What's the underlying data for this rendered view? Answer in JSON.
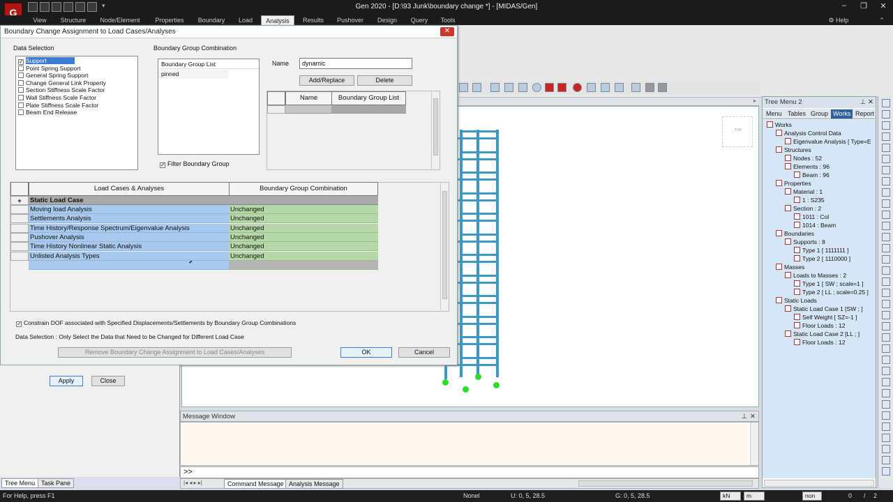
{
  "window": {
    "title": "Gen 2020 - [D:\\93 Junk\\boundary change *] - [MIDAS/Gen]",
    "help_label": "Help"
  },
  "menu": [
    "View",
    "Structure",
    "Node/Element",
    "Properties",
    "Boundary",
    "Load",
    "Analysis",
    "Results",
    "Pushover",
    "Design",
    "Query",
    "Tools"
  ],
  "active_menu": "Analysis",
  "dialog": {
    "title": "Boundary Change Assignment to Load Cases/Analyses",
    "data_selection": {
      "label": "Data Selection",
      "items": [
        {
          "label": "Support",
          "checked": true,
          "selected": true
        },
        {
          "label": "Point Spring Support",
          "checked": false
        },
        {
          "label": "General Spring Support",
          "checked": false
        },
        {
          "label": "Change General Link Property",
          "checked": false
        },
        {
          "label": "Section Stiffness Scale Factor",
          "checked": false
        },
        {
          "label": "Wall Stiffness Scale Factor",
          "checked": false
        },
        {
          "label": "Plate Stiffness Scale Factor",
          "checked": false
        },
        {
          "label": "Beam End Release",
          "checked": false
        }
      ]
    },
    "bgc": {
      "label": "Boundary Group Combination",
      "list_header": "Boundary Group List",
      "list_items": [
        "pinned"
      ],
      "filter_label": "Filter Boundary Group",
      "name_label": "Name",
      "name_value": "dynamic",
      "add_replace": "Add/Replace",
      "delete": "Delete",
      "grid_headers": [
        "Name",
        "Boundary Group List"
      ]
    },
    "table": {
      "headers": [
        "Load Cases & Analyses",
        "Boundary Group Combination"
      ],
      "group_row": {
        "marker": "+",
        "label": "Static Load Case"
      },
      "rows": [
        {
          "case": "Moving load Analysis",
          "combo": "Unchanged"
        },
        {
          "case": "Settlements Analysis",
          "combo": "Unchanged"
        },
        {
          "case": "Time History/Response Spectrum/Eigenvalue Analysis",
          "combo": "Unchanged"
        },
        {
          "case": "Pushover Analysis",
          "combo": "Unchanged"
        },
        {
          "case": "Time History Nonlinear Static Analysis",
          "combo": "Unchanged"
        },
        {
          "case": "Unlisted Analysis Types",
          "combo": "Unchanged"
        }
      ]
    },
    "constrain_label": "Constrain DOF associated with Specified Displacements/Settlements by Boundary Group Combinations",
    "note": "Data Selection : Only Select the Data that Need to be Changed for Different Load Case",
    "remove_label": "Remove Boundary Change Assignment to Load Cases/Analyses",
    "ok": "OK",
    "cancel": "Cancel"
  },
  "left_panel": {
    "apply": "Apply",
    "close": "Close",
    "tabs": [
      "Tree Menu",
      "Task Pane"
    ]
  },
  "message": {
    "title": "Message Window",
    "prompt": ">>",
    "tabs": [
      "Command Message",
      "Analysis Message"
    ]
  },
  "status": {
    "help": "For Help, press F1",
    "none": "Nonel",
    "u": "U: 0, 5, 28.5",
    "g": "G: 0, 5, 28.5",
    "unit_force": "kN",
    "unit_len": "m",
    "sel": "non",
    "page_cur": "0",
    "page_sep": "/",
    "page_tot": "2"
  },
  "tree": {
    "title": "Tree Menu 2",
    "tabs": [
      "Menu",
      "Tables",
      "Group",
      "Works",
      "Report"
    ],
    "active_tab": "Works",
    "nodes": [
      {
        "t": "Works",
        "lvl": 0
      },
      {
        "t": "Analysis Control Data",
        "lvl": 1
      },
      {
        "t": "Eigenvalue Analysis [ Type=E",
        "lvl": 2
      },
      {
        "t": "Structures",
        "lvl": 1
      },
      {
        "t": "Nodes : 52",
        "lvl": 2
      },
      {
        "t": "Elements : 96",
        "lvl": 2
      },
      {
        "t": "Beam : 96",
        "lvl": 3
      },
      {
        "t": "Properties",
        "lvl": 1
      },
      {
        "t": "Material : 1",
        "lvl": 2
      },
      {
        "t": "1 : S235",
        "lvl": 3
      },
      {
        "t": "Section : 2",
        "lvl": 2
      },
      {
        "t": "1011 : Col",
        "lvl": 3
      },
      {
        "t": "1014 : Beam",
        "lvl": 3
      },
      {
        "t": "Boundaries",
        "lvl": 1
      },
      {
        "t": "Supports : 8",
        "lvl": 2
      },
      {
        "t": "Type 1 [ 1111111 ]",
        "lvl": 3
      },
      {
        "t": "Type 2 [ 1110000 ]",
        "lvl": 3
      },
      {
        "t": "Masses",
        "lvl": 1
      },
      {
        "t": "Loads to Masses : 2",
        "lvl": 2
      },
      {
        "t": "Type 1 [ SW ; scale=1 ]",
        "lvl": 3
      },
      {
        "t": "Type 2 [ LL ; scale=0.25 ]",
        "lvl": 3
      },
      {
        "t": "Static Loads",
        "lvl": 1
      },
      {
        "t": "Static Load Case 1 [SW ; ]",
        "lvl": 2
      },
      {
        "t": "Self Weight [ SZ=-1 ]",
        "lvl": 3
      },
      {
        "t": "Floor Loads : 12",
        "lvl": 3
      },
      {
        "t": "Static Load Case 2 [LL ; ]",
        "lvl": 2
      },
      {
        "t": "Floor Loads : 12",
        "lvl": 3
      }
    ]
  },
  "view_cube_label": "TOP",
  "colors": {
    "accent": "#2f5f9e",
    "case_cell": "#a7c9ed",
    "combo_cell": "#b6d8a8",
    "model": "#3c97c6",
    "support": "#2bdc2b"
  }
}
